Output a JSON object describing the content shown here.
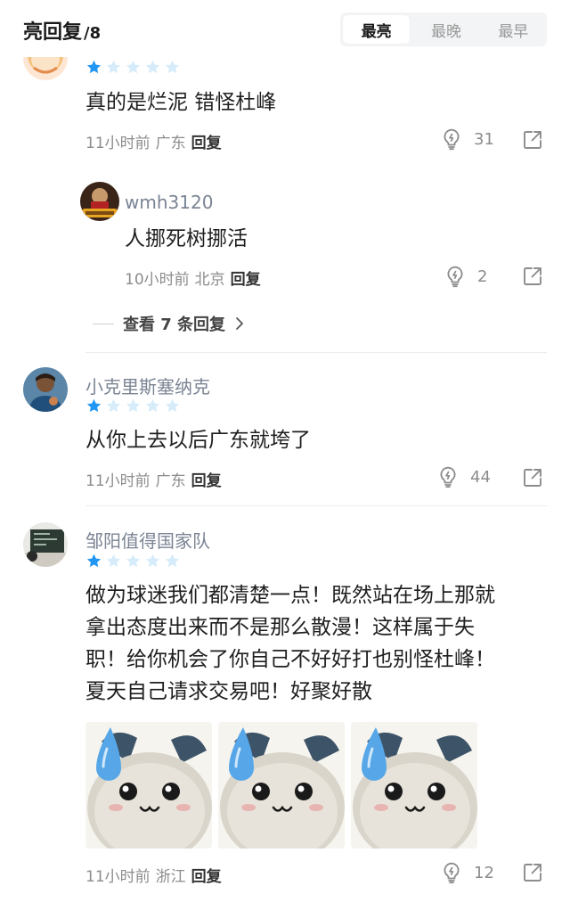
{
  "header": {
    "title": "亮回复",
    "count": "/8",
    "sort_tabs": [
      {
        "label": "最亮",
        "active": true
      },
      {
        "label": "最晚",
        "active": false
      },
      {
        "label": "最早",
        "active": false
      }
    ]
  },
  "comments": [
    {
      "rating": 1,
      "text": "真的是烂泥 错怪杜峰",
      "time": "11小时前",
      "location": "广东",
      "reply_label": "回复",
      "likes": "31",
      "reply": {
        "username": "wmh3120",
        "text": "人挪死树挪活",
        "time": "10小时前",
        "location": "北京",
        "reply_label": "回复",
        "likes": "2"
      },
      "view_replies": "查看 7 条回复"
    },
    {
      "username": "小克里斯塞纳克",
      "rating": 1,
      "text": "从你上去以后广东就垮了",
      "time": "11小时前",
      "location": "广东",
      "reply_label": "回复",
      "likes": "44"
    },
    {
      "username": "邹阳值得国家队",
      "rating": 1,
      "text_lines": [
        "做为球迷我们都清楚一点！既然站在场上那就",
        "拿出态度出来而不是那么散漫！这样属于失",
        "职！给你机会了你自己不好好打也别怪杜峰！",
        "夏天自己请求交易吧！好聚好散"
      ],
      "time": "11小时前",
      "location": "浙江",
      "reply_label": "回复",
      "likes": "12",
      "stickers": [
        "sweat-drop-cat-sticker",
        "sweat-drop-cat-sticker",
        "sweat-drop-cat-sticker"
      ]
    }
  ],
  "colors": {
    "star_active": "#2196f3",
    "star_inactive": "#d6ecfb",
    "meta_text": "#8c8c8c",
    "username": "#7b8494"
  },
  "icons": {
    "like": "lightbulb-icon",
    "share": "share-icon",
    "chevron": "chevron-right-icon"
  }
}
